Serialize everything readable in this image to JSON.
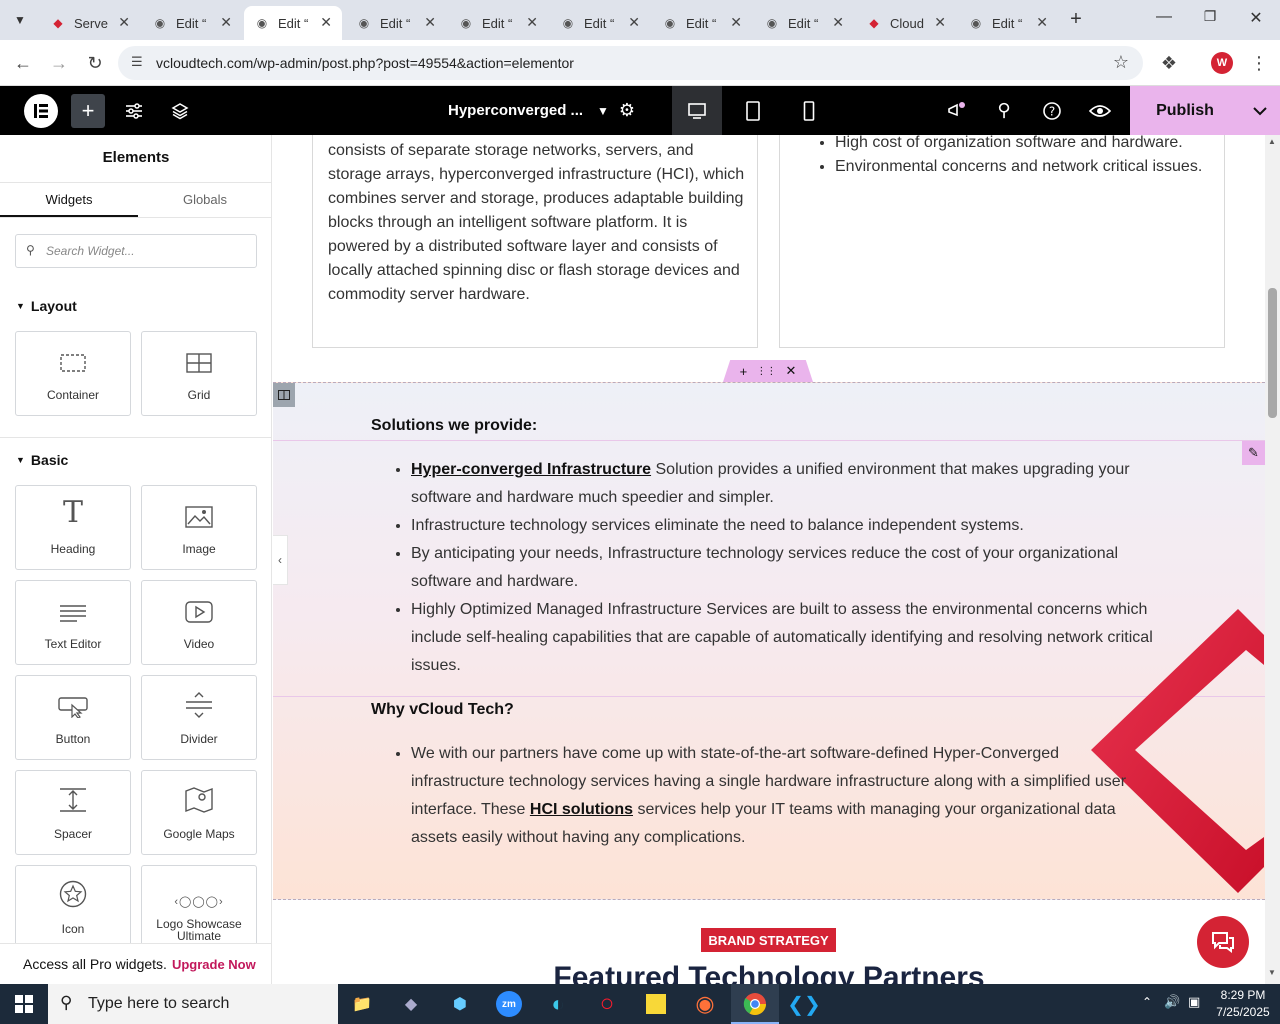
{
  "browser": {
    "tabs": [
      {
        "title": "Serve",
        "icon": "app-icon"
      },
      {
        "title": "Edit “",
        "icon": "wordpress-icon"
      },
      {
        "title": "Edit “",
        "icon": "wordpress-icon"
      },
      {
        "title": "Edit “",
        "icon": "wordpress-icon"
      },
      {
        "title": "Edit “",
        "icon": "wordpress-icon"
      },
      {
        "title": "Edit “",
        "icon": "wordpress-icon"
      },
      {
        "title": "Edit “",
        "icon": "wordpress-icon"
      },
      {
        "title": "Edit “",
        "icon": "wordpress-icon"
      },
      {
        "title": "Cloud",
        "icon": "app-icon"
      },
      {
        "title": "Edit “",
        "icon": "wordpress-icon"
      }
    ],
    "active_tab_index": 2,
    "url": "vcloudtech.com/wp-admin/post.php?post=49554&action=elementor",
    "profile_initial": "W"
  },
  "editor": {
    "page_title": "Hyperconverged ...",
    "publish_label": "Publish",
    "sidebar": {
      "title": "Elements",
      "tabs": [
        "Widgets",
        "Globals"
      ],
      "search_placeholder": "Search Widget...",
      "layout_label": "Layout",
      "basic_label": "Basic",
      "layout_widgets": [
        "Container",
        "Grid"
      ],
      "basic_widgets": [
        "Heading",
        "Image",
        "Text Editor",
        "Video",
        "Button",
        "Divider",
        "Spacer",
        "Google Maps",
        "Icon",
        "Logo Showcase Ultimate"
      ],
      "pro_text": "Access all Pro widgets.",
      "pro_link": "Upgrade Now"
    }
  },
  "content": {
    "left_card_text": "consists of separate storage networks, servers, and storage arrays, hyperconverged infrastructure (HCI), which combines server and storage, produces adaptable building blocks through an intelligent software platform. It is powered by a distributed software layer and consists of locally attached spinning disc or flash storage devices and commodity server hardware.",
    "right_card_items": [
      "High cost of organization software and hardware.",
      "Environmental concerns and network critical issues."
    ],
    "solutions_heading": "Solutions we provide:",
    "solutions_items": [
      {
        "link": "Hyper-converged Infrastructure",
        "text": " Solution provides a unified environment that makes upgrading your software and hardware much speedier and simpler."
      },
      {
        "link": "",
        "text": "Infrastructure technology services eliminate the need to balance independent systems."
      },
      {
        "link": "",
        "text": "By anticipating your needs, Infrastructure technology services reduce the cost of your organizational software and hardware."
      },
      {
        "link": "",
        "text": "Highly Optimized Managed Infrastructure Services are built to assess the environmental concerns which include self-healing capabilities that are capable of automatically identifying and resolving network critical issues."
      }
    ],
    "why_heading": "Why vCloud Tech?",
    "why_item": {
      "before": "We with our partners have come up with state-of-the-art software-defined Hyper-Converged infrastructure technology services having a single hardware infrastructure along with a simplified user interface. These ",
      "link": "HCI solutions",
      "after": " services help your IT teams with managing your organizational data assets easily without having any complications."
    },
    "badge": "BRAND STRATEGY",
    "partners_heading": "Featured Technology Partners"
  },
  "taskbar": {
    "search_placeholder": "Type here to search",
    "time": "8:29 PM",
    "date": "7/25/2025"
  },
  "colors": {
    "elementor_black": "#000000",
    "publish_pink": "#eab4ec",
    "brand_red": "#d42334",
    "section_purple": "#c36ac5"
  }
}
